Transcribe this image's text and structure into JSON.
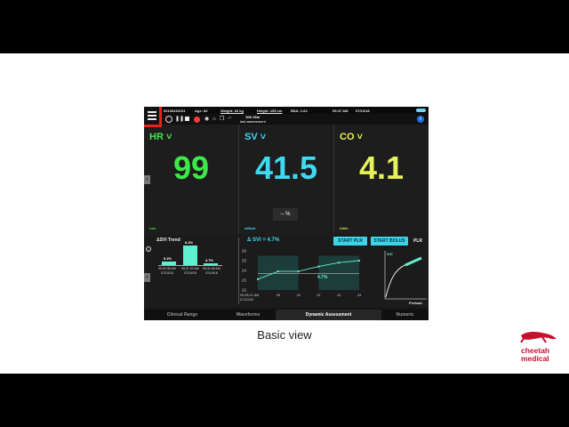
{
  "status": {
    "patient_id": "00106430131",
    "age": "Age: 82",
    "weight": "Weight: 63 kg",
    "height": "Height: 155 cm",
    "bsa": "BSA: 1.62",
    "time": "09:47 AM",
    "date": "07/10/18"
  },
  "toolbar": {
    "elapsed_time": "00h 03m",
    "elapsed_caption": "last assessment",
    "info": "i"
  },
  "panels": {
    "hr": {
      "label": "HR",
      "value": "99",
      "foot": "Low"
    },
    "sv": {
      "label": "SV",
      "value": "41.5",
      "foot": "ml/beat",
      "pct": "-- %"
    },
    "co": {
      "label": "CO",
      "value": "4.1",
      "foot": "L/min"
    }
  },
  "trend": {
    "title": "ΔSVI Trend",
    "bars": [
      {
        "value": "5.2%",
        "pct": 5.2,
        "time": "09:20:38 AM",
        "date": "07/10/18"
      },
      {
        "value": "6.2%",
        "pct": 6.2,
        "time": "09:37:22 AM",
        "date": "07/10/18"
      },
      {
        "value": "4.7%",
        "pct": 4.7,
        "time": "09:42:49 AM",
        "date": "07/10/18"
      }
    ]
  },
  "assessment": {
    "delta": "Δ SVI = 4.7%",
    "start_plr": "START PLR",
    "start_bolus": "START BOLUS",
    "plr_tab": "PLR",
    "plr_label": "SVI",
    "preload_label": "Preload",
    "annotation": "4.7%",
    "y_ticks": [
      "26",
      "25",
      "24",
      "23",
      "22"
    ],
    "x_ticks": [
      "09:35:21 AM",
      "39",
      "40",
      "41",
      "42",
      "43"
    ],
    "x_date": "07/10/18"
  },
  "chart_data": {
    "type": "line",
    "x": [
      0,
      1,
      2,
      3,
      4,
      5
    ],
    "y": [
      23.1,
      23.9,
      23.9,
      24.4,
      24.8,
      25.0
    ],
    "ylim": [
      22,
      26
    ]
  },
  "bottom_tabs": [
    {
      "label": "Clinical Range",
      "active": false
    },
    {
      "label": "Waveforms",
      "active": false
    },
    {
      "label": "Dynamic Assessment",
      "active": true
    },
    {
      "label": "Numeric",
      "active": false
    }
  ],
  "caption": "Basic view",
  "logo": {
    "line1": "cheetah",
    "line2": "medical",
    "color": "#c8102e"
  },
  "colors": {
    "hr": "#3ee84a",
    "sv": "#3fd9f0",
    "co": "#e6f05a",
    "highlight": "#ef1f1f"
  }
}
